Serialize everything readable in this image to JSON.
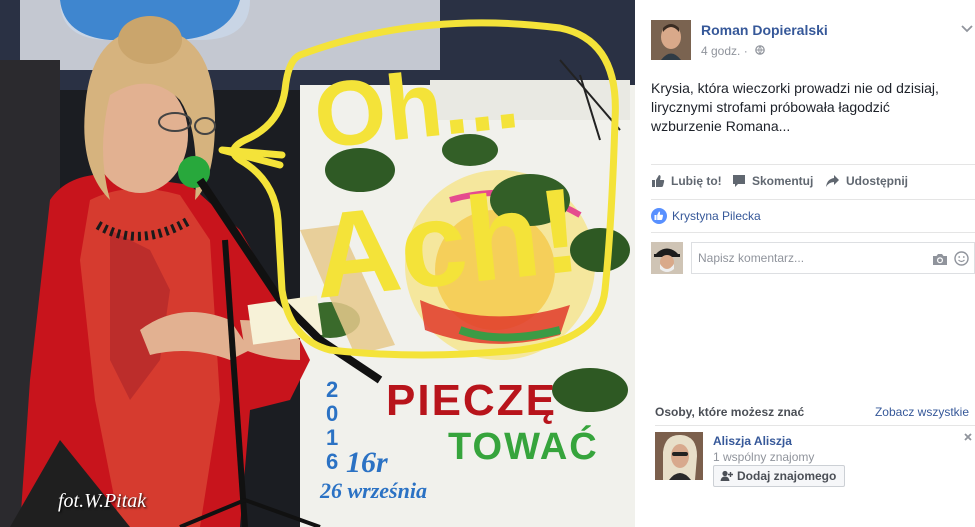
{
  "photo": {
    "annotation_line1": "Oh...",
    "annotation_line2": "Ach!",
    "annotation_color": "#f4e339",
    "poster_word1": "PIECZĘ",
    "poster_word2": "TOWAĆ",
    "poster_year": "2016r",
    "poster_year_display": "16r",
    "poster_year_left": "2016",
    "poster_date": "26 września",
    "credit": "fot.W.Pitak"
  },
  "post": {
    "author": "Roman Dopieralski",
    "time": "4 godz. ·",
    "caption": "Krysia, która wieczorki prowadzi nie od dzisiaj, lirycznymi strofami próbowała łagodzić wzburzenie Romana...",
    "actions": {
      "like": "Lubię to!",
      "comment": "Skomentuj",
      "share": "Udostępnij"
    },
    "liked_by": "Krystyna Pilecka",
    "comment_placeholder": "Napisz komentarz..."
  },
  "suggestions": {
    "title": "Osoby, które możesz znać",
    "see_all": "Zobacz wszystkie",
    "person": {
      "name": "Aliszja Aliszja",
      "mutual": "1 wspólny znajomy",
      "add_label": "Dodaj znajomego"
    }
  },
  "colors": {
    "link": "#365899",
    "muted": "#90949c",
    "annotation": "#f4e339",
    "poster_red": "#b8141b",
    "poster_green": "#36a43c",
    "poster_blue": "#2b72c4"
  },
  "icons": {
    "globe": "globe-icon",
    "chevron": "chevron-down-icon",
    "like": "thumbs-up-icon",
    "comment": "comment-bubble-icon",
    "share": "share-arrow-icon",
    "liked": "like-circle-icon",
    "camera": "camera-icon",
    "emoji": "smiley-icon",
    "add_friend": "add-friend-icon",
    "dismiss": "close-icon"
  }
}
